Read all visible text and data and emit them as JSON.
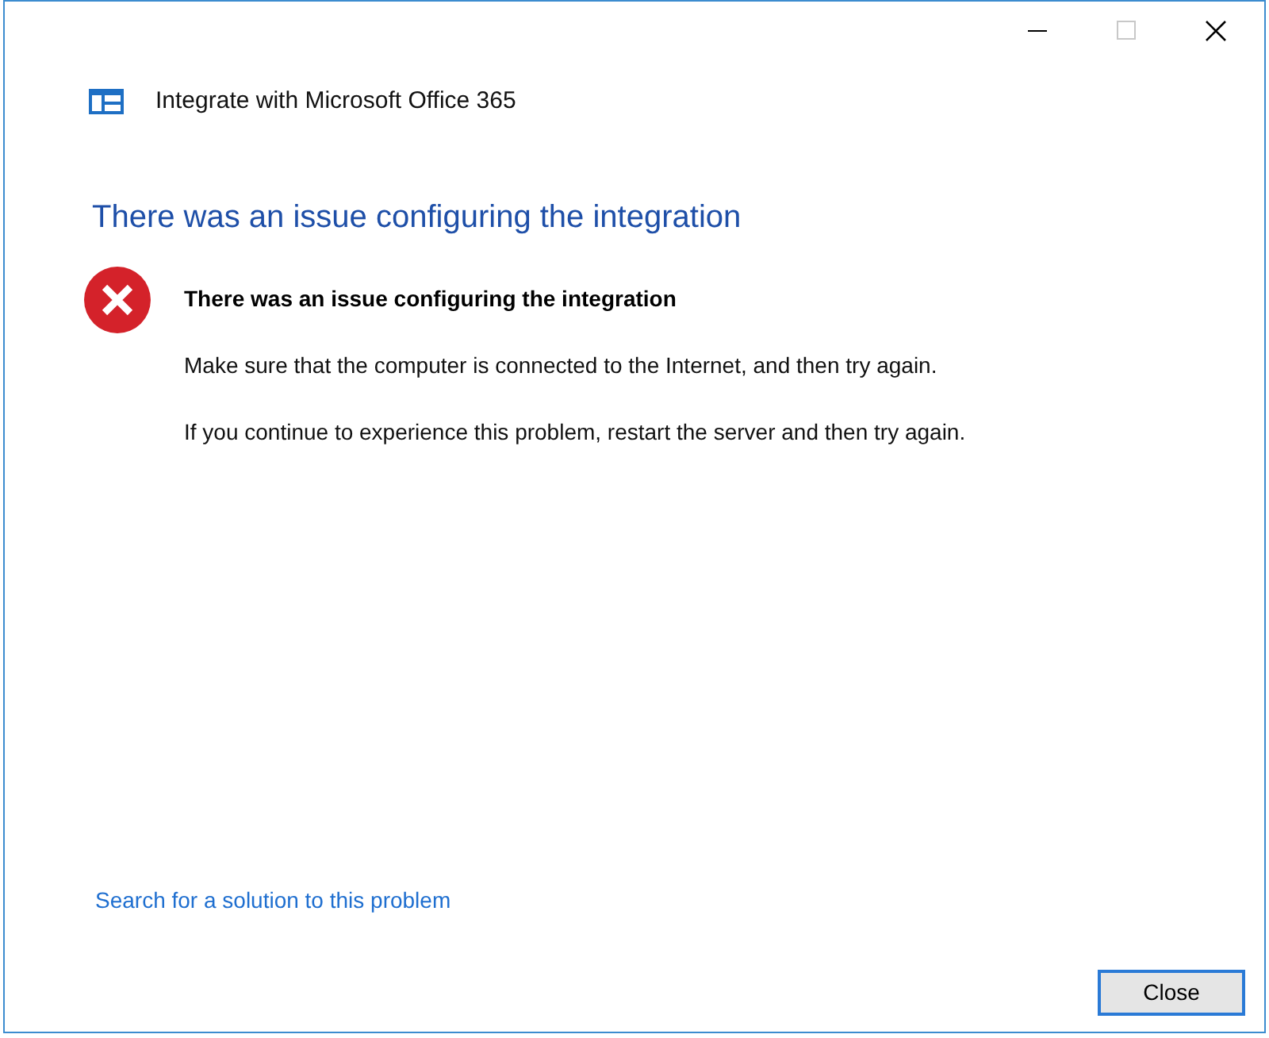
{
  "window": {
    "title": "Integrate with Microsoft Office 365"
  },
  "heading": "There was an issue configuring the integration",
  "message": {
    "title": "There was an issue configuring the integration",
    "lines": [
      "Make sure that the computer is connected to the Internet, and then try again.",
      "If you continue to experience this problem, restart the server and then try again."
    ]
  },
  "link": "Search for a solution to this problem",
  "buttons": [
    "Close"
  ]
}
